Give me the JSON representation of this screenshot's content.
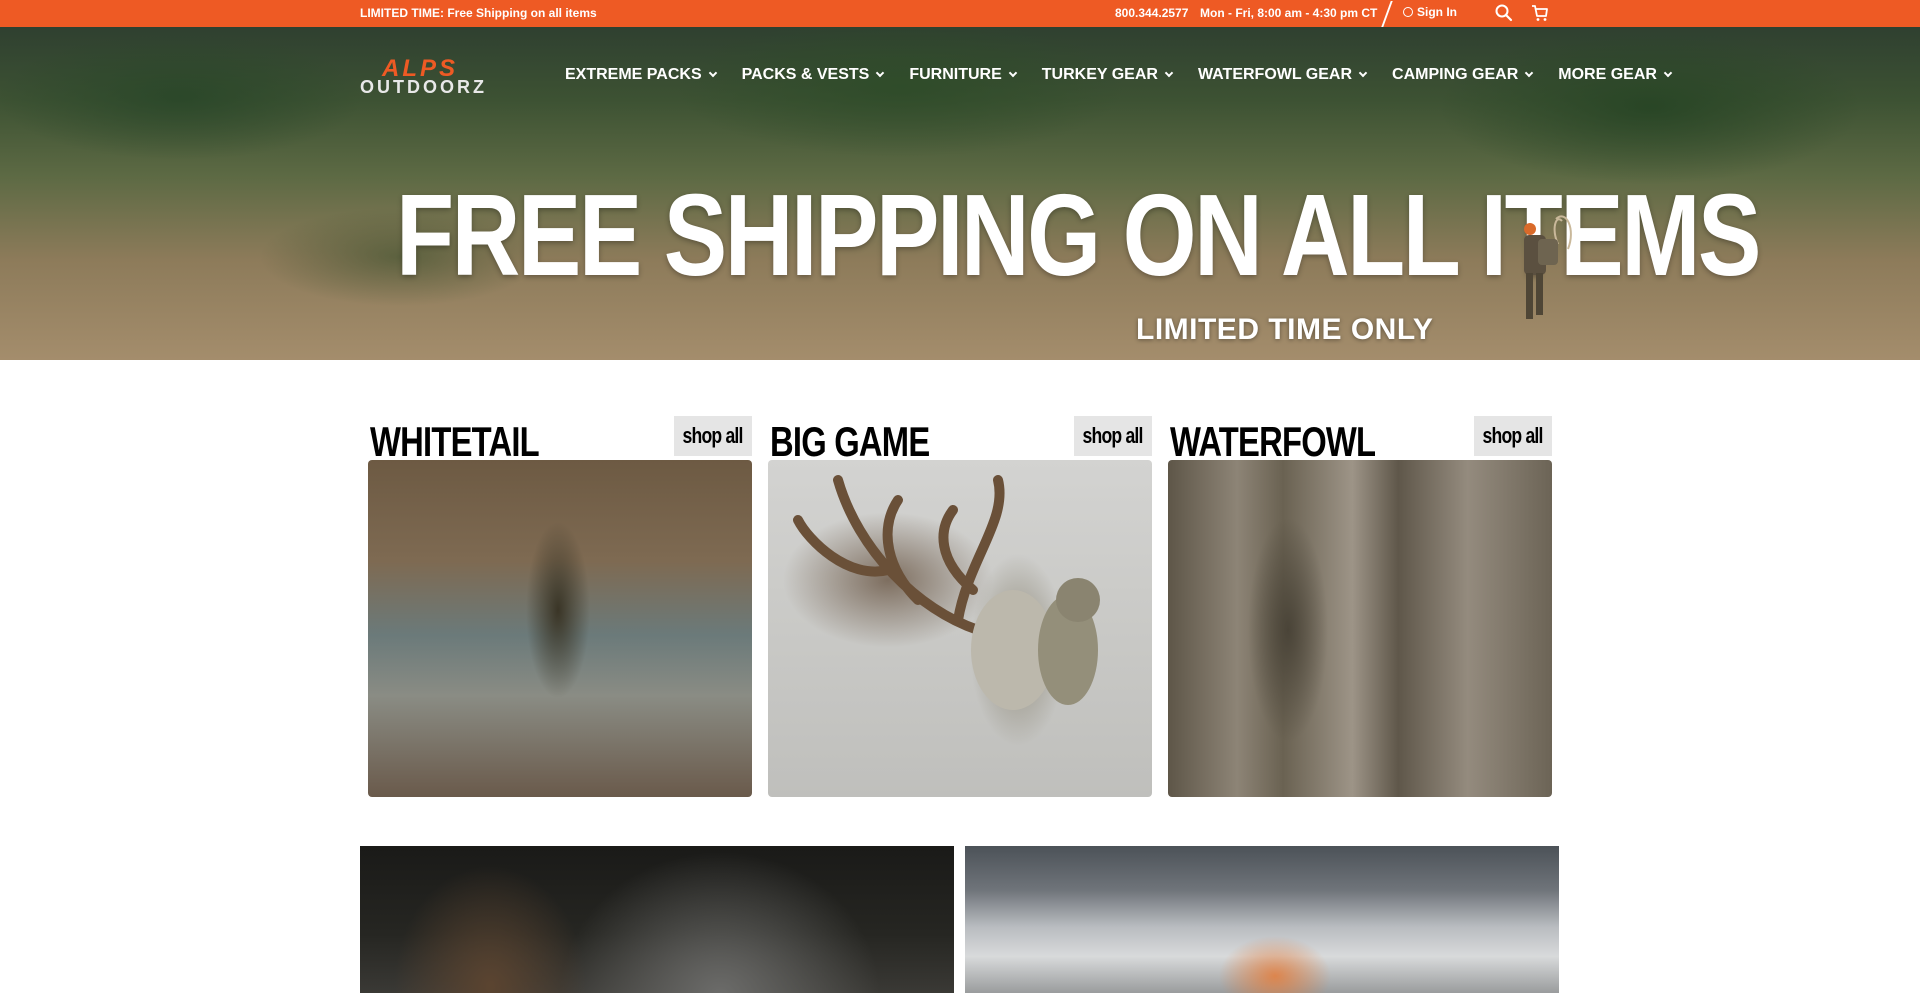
{
  "topbar": {
    "promo": "LIMITED TIME: Free Shipping on all items",
    "phone": "800.344.2577",
    "hours": "Mon - Fri, 8:00 am - 4:30 pm CT",
    "signin": "Sign In",
    "search_icon": "search-icon",
    "cart_icon": "cart-icon",
    "bg_color": "#ee5a24"
  },
  "header": {
    "logo_line1": "ALPS",
    "logo_line2": "OUTDOORZ",
    "menu": [
      {
        "label": "EXTREME PACKS"
      },
      {
        "label": "PACKS & VESTS"
      },
      {
        "label": "FURNITURE"
      },
      {
        "label": "TURKEY GEAR"
      },
      {
        "label": "WATERFOWL GEAR"
      },
      {
        "label": "CAMPING GEAR"
      },
      {
        "label": "MORE GEAR"
      }
    ]
  },
  "hero": {
    "title": "FREE SHIPPING ON ALL ITEMS",
    "subtitle": "LIMITED TIME ONLY"
  },
  "categories": [
    {
      "title": "WHITETAIL",
      "button": "shop all"
    },
    {
      "title": "BIG GAME",
      "button": "shop all"
    },
    {
      "title": "WATERFOWL",
      "button": "shop all"
    }
  ]
}
